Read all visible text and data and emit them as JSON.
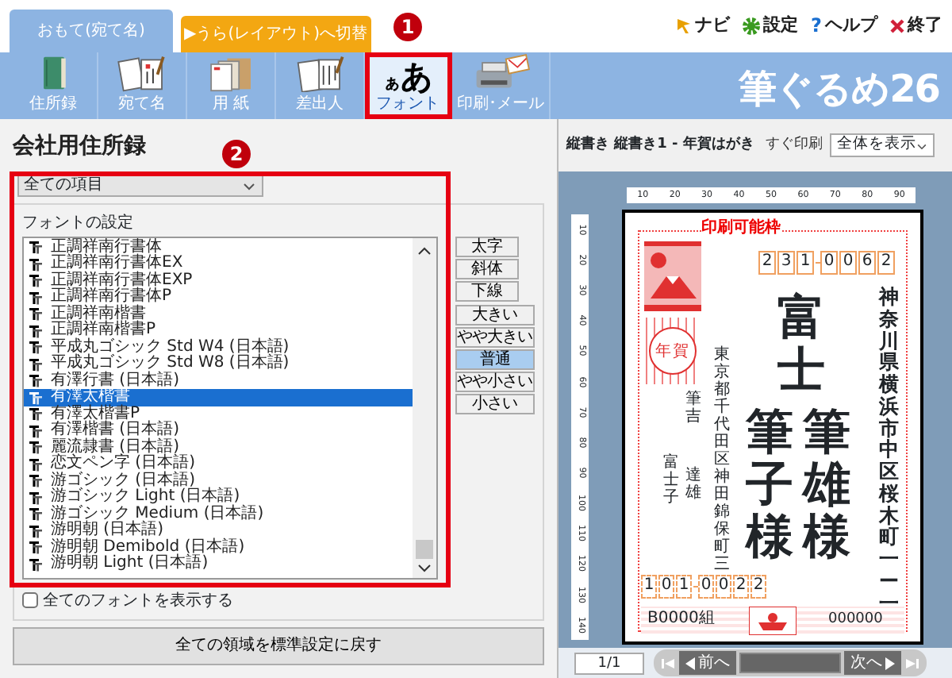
{
  "mode_tabs": [
    {
      "label": "おもて(宛て名)",
      "selected": true
    },
    {
      "label": "▶うら(レイアウト)へ切替",
      "selected": false
    }
  ],
  "top_links": [
    {
      "kind": "navi",
      "label": "ナビ"
    },
    {
      "kind": "settings",
      "label": "設定"
    },
    {
      "kind": "help",
      "label": "ヘルプ",
      "glyph": "?"
    },
    {
      "kind": "exit",
      "label": "終了"
    }
  ],
  "toolbar": [
    {
      "kind": "book",
      "label": "住所録",
      "selected": false
    },
    {
      "kind": "cards",
      "label": "宛て名",
      "selected": false
    },
    {
      "kind": "paper",
      "label": "用 紙",
      "selected": false
    },
    {
      "kind": "sender",
      "label": "差出人",
      "selected": false
    },
    {
      "kind": "glyph",
      "label": "フォント",
      "selected": true,
      "glyph_small": "ぁ",
      "glyph_large": "あ"
    },
    {
      "kind": "printer",
      "label": "印刷･メール",
      "selected": false
    }
  ],
  "logo": "筆ぐるめ26",
  "callouts": [
    "1",
    "2"
  ],
  "panel": {
    "title": "会社用住所録",
    "scope_select": "全ての項目",
    "group_label": "フォントの設定",
    "fonts": [
      {
        "name": "正調祥南行書体",
        "selected": false
      },
      {
        "name": "正調祥南行書体EX",
        "selected": false
      },
      {
        "name": "正調祥南行書体EXP",
        "selected": false
      },
      {
        "name": "正調祥南行書体P",
        "selected": false
      },
      {
        "name": "正調祥南楷書",
        "selected": false
      },
      {
        "name": "正調祥南楷書P",
        "selected": false
      },
      {
        "name": "平成丸ゴシック Std W4 (日本語)",
        "selected": false
      },
      {
        "name": "平成丸ゴシック Std W8 (日本語)",
        "selected": false
      },
      {
        "name": "有澤行書 (日本語)",
        "selected": false
      },
      {
        "name": "有澤太楷書",
        "selected": true
      },
      {
        "name": "有澤太楷書P",
        "selected": false
      },
      {
        "name": "有澤楷書 (日本語)",
        "selected": false
      },
      {
        "name": "麗流隷書 (日本語)",
        "selected": false
      },
      {
        "name": "恋文ペン字 (日本語)",
        "selected": false
      },
      {
        "name": "游ゴシック (日本語)",
        "selected": false
      },
      {
        "name": "游ゴシック Light (日本語)",
        "selected": false
      },
      {
        "name": "游ゴシック Medium (日本語)",
        "selected": false
      },
      {
        "name": "游明朝 (日本語)",
        "selected": false
      },
      {
        "name": "游明朝 Demibold (日本語)",
        "selected": false
      },
      {
        "name": "游明朝 Light (日本語)",
        "selected": false
      }
    ],
    "style_buttons": [
      "太字",
      "斜体",
      "下線"
    ],
    "size_buttons": [
      {
        "label": "大きい",
        "selected": false
      },
      {
        "label": "やや大きい",
        "selected": false
      },
      {
        "label": "普通",
        "selected": true
      },
      {
        "label": "やや小さい",
        "selected": false
      },
      {
        "label": "小さい",
        "selected": false
      }
    ],
    "show_all": {
      "label": "全てのフォントを表示する",
      "checked": false
    },
    "reset_button": "全ての領域を標準設定に戻す"
  },
  "preview": {
    "title": "縦書き 縦書き1 - 年賀はがき",
    "quick_print": "すぐ印刷",
    "zoom_select": "全体を表示",
    "ruler_h": [
      "10",
      "20",
      "30",
      "40",
      "50",
      "60",
      "70",
      "80",
      "90"
    ],
    "ruler_v": [
      "10",
      "20",
      "30",
      "40",
      "50",
      "60",
      "70",
      "80",
      "90",
      "100",
      "110",
      "120",
      "130",
      "140"
    ],
    "card": {
      "print_frame": "印刷可能枠",
      "postmark": "年賀",
      "postcode": [
        "2",
        "3",
        "1",
        "0",
        "0",
        "6",
        "2"
      ],
      "address": "神奈川県横浜市中区桜木町一ー一",
      "name_top": "富士",
      "names": [
        "筆子様",
        "筆雄様"
      ],
      "sender_address": "東京都千代田区神田錦保町三",
      "sender_family": "筆吉",
      "sender_names": [
        "富士子",
        "達雄"
      ],
      "sender_postcode": [
        "1",
        "0",
        "1",
        "0",
        "0",
        "2",
        "2"
      ],
      "lottery_group": "B0000組",
      "lottery_number": "000000"
    },
    "page": "1/1",
    "prev": "前へ",
    "next": "次へ"
  }
}
